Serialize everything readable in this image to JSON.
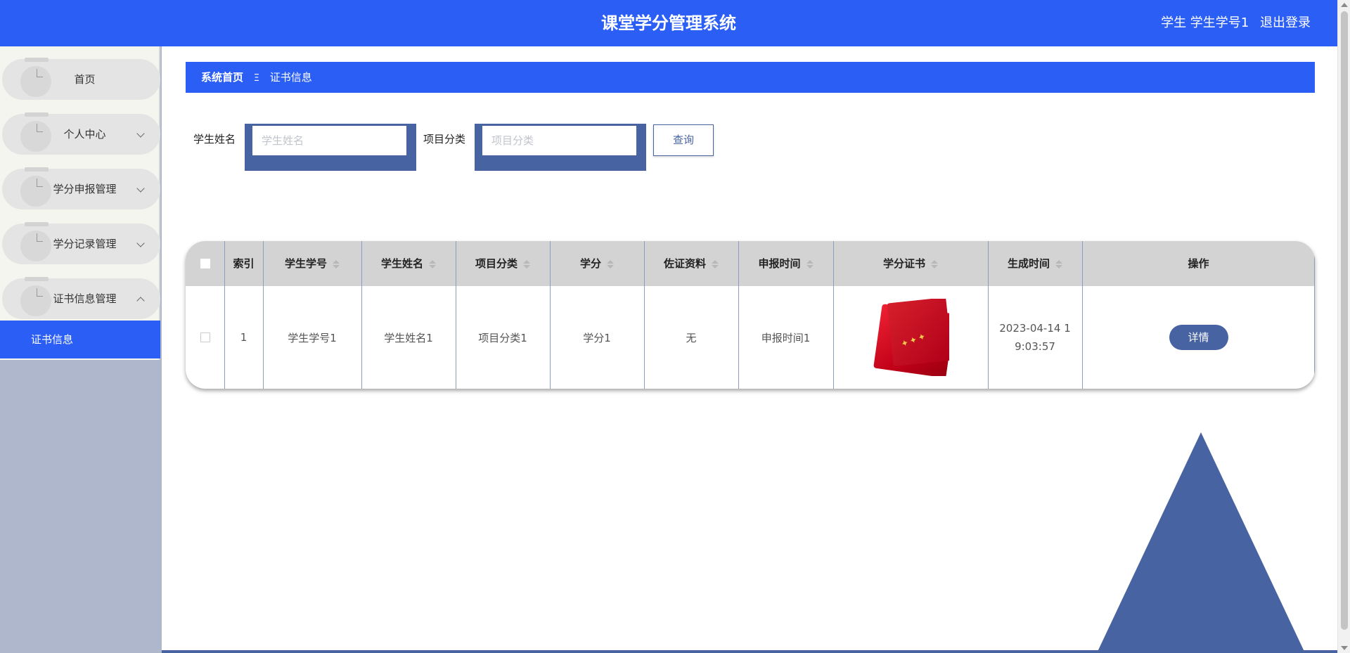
{
  "header": {
    "title": "课堂学分管理系统",
    "user_role_name": "学生 学生学号1",
    "logout_label": "退出登录"
  },
  "sidebar": {
    "items": [
      {
        "label": "首页",
        "has_children": false
      },
      {
        "label": "个人中心",
        "has_children": true,
        "expanded": false
      },
      {
        "label": "学分申报管理",
        "has_children": true,
        "expanded": false
      },
      {
        "label": "学分记录管理",
        "has_children": true,
        "expanded": false
      },
      {
        "label": "证书信息管理",
        "has_children": true,
        "expanded": true
      }
    ],
    "active_subitem": "证书信息"
  },
  "breadcrumb": {
    "home": "系统首页",
    "separator": "Ξ",
    "current": "证书信息"
  },
  "search": {
    "name_label": "学生姓名",
    "name_placeholder": "学生姓名",
    "category_label": "项目分类",
    "category_placeholder": "项目分类",
    "query_button": "查询"
  },
  "table": {
    "columns": [
      "索引",
      "学生学号",
      "学生姓名",
      "项目分类",
      "学分",
      "佐证资料",
      "申报时间",
      "学分证书",
      "生成时间",
      "操作"
    ],
    "rows": [
      {
        "index": "1",
        "student_id": "学生学号1",
        "student_name": "学生姓名1",
        "category": "项目分类1",
        "credit": "学分1",
        "evidence": "无",
        "apply_time": "申报时间1",
        "certificate_image": "certificate-photo",
        "gen_time": "2023-04-14 19:03:57",
        "action": "详情"
      }
    ]
  },
  "colors": {
    "primary": "#2a5ef5",
    "accent": "#4763a2",
    "sidebar_bg": "#aeb7cc"
  }
}
